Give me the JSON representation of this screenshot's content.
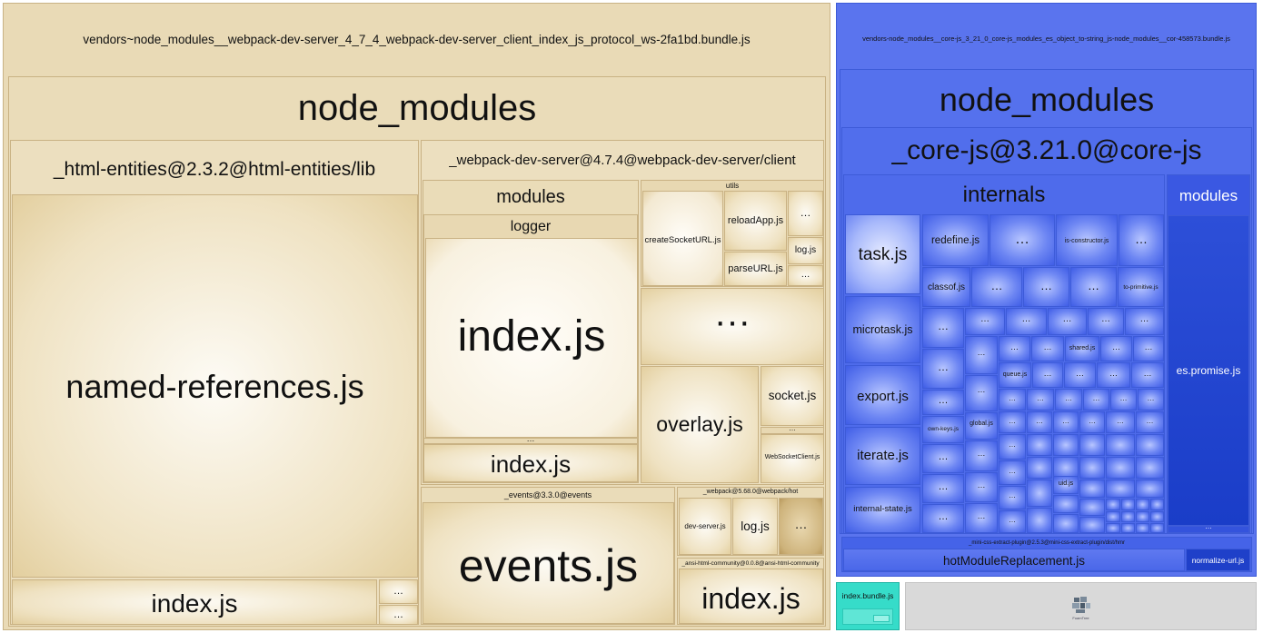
{
  "tiles": {
    "y_bundle": "vendors~node_modules__webpack-dev-server_4_7_4_webpack-dev-server_client_index_js_protocol_ws-2fa1bd.bundle.js",
    "y_node_modules": "node_modules",
    "y_html_entities": "_html-entities@2.3.2@html-entities/lib",
    "y_named_refs": "named-references.js",
    "y_he_index": "index.js",
    "ellipsis": "…",
    "big_ellipsis": "···",
    "y_wds_client": "_webpack-dev-server@4.7.4@webpack-dev-server/client",
    "y_modules": "modules",
    "y_logger": "logger",
    "y_logger_index": "index.js",
    "y_modules_index": "index.js",
    "y_utils": "utils",
    "y_create_socket": "createSocketURL.js",
    "y_reload_app": "reloadApp.js",
    "y_parse_url": "parseURL.js",
    "y_log": "log.js",
    "y_overlay": "overlay.js",
    "y_socket": "socket.js",
    "y_ws_client": "WebSocketClient.js",
    "y_events_pkg": "_events@3.3.0@events",
    "y_events_js": "events.js",
    "y_webpack_hot": "_webpack@5.68.0@webpack/hot",
    "y_dev_server": "dev-server.js",
    "y_hot_log": "log.js",
    "y_ansi": "_ansi-html-community@0.0.8@ansi-html-community",
    "y_ansi_index": "index.js",
    "b_bundle": "vendors-node_modules__core-js_3_21_0_core-js_modules_es_object_to-string_js-node_modules__cor-458573.bundle.js",
    "b_node_modules": "node_modules",
    "b_core_js": "_core-js@3.21.0@core-js",
    "b_internals": "internals",
    "b_modules": "modules",
    "b_task": "task.js",
    "b_microtask": "microtask.js",
    "b_export": "export.js",
    "b_iterate": "iterate.js",
    "b_internal_state": "internal-state.js",
    "b_redefine": "redefine.js",
    "b_is_constructor": "is-constructor.js",
    "b_classof": "classof.js",
    "b_to_primitive": "to-primitive.js",
    "b_shared": "shared.js",
    "b_queue": "queue.js",
    "b_own_keys": "own-keys.js",
    "b_global": "global.js",
    "b_uid": "uid.js",
    "b_es_promise": "es.promise.js",
    "b_mini_css": "_mini-css-extract-plugin@2.5.3@mini-css-extract-plugin/dist/hmr",
    "b_hmr": "hotModuleReplacement.js",
    "b_normalize_url": "normalize-url.js",
    "t_index_bundle": "index.bundle.js",
    "g_label": "FoamTree"
  },
  "colors": {
    "yellow_base": "#e8d8b0",
    "blue_base": "#4a68ea",
    "teal": "#2fd3c4",
    "gray": "#d8d8d8"
  }
}
